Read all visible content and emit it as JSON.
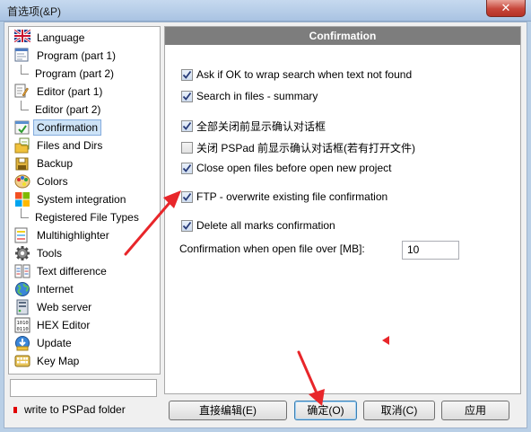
{
  "window": {
    "title": "首选项(&P)",
    "close_label": "✕"
  },
  "tree": {
    "items": [
      {
        "label": "Language",
        "icon": "uk-flag-icon",
        "level": 0
      },
      {
        "label": "Program  (part 1)",
        "icon": "program-window-icon",
        "level": 0
      },
      {
        "label": "Program  (part 2)",
        "icon": "",
        "level": 1
      },
      {
        "label": "Editor  (part 1)",
        "icon": "editor-pencil-icon",
        "level": 0
      },
      {
        "label": "Editor  (part 2)",
        "icon": "",
        "level": 1
      },
      {
        "label": "Confirmation",
        "icon": "confirmation-icon",
        "level": 0,
        "selected": true
      },
      {
        "label": "Files and Dirs",
        "icon": "files-dirs-icon",
        "level": 0
      },
      {
        "label": "Backup",
        "icon": "backup-icon",
        "level": 0
      },
      {
        "label": "Colors",
        "icon": "colors-palette-icon",
        "level": 0
      },
      {
        "label": "System integration",
        "icon": "windows-logo-icon",
        "level": 0
      },
      {
        "label": "Registered File Types",
        "icon": "",
        "level": 1
      },
      {
        "label": "Multihighlighter",
        "icon": "multihighlighter-icon",
        "level": 0
      },
      {
        "label": "Tools",
        "icon": "gear-icon",
        "level": 0
      },
      {
        "label": "Text difference",
        "icon": "text-difference-icon",
        "level": 0
      },
      {
        "label": "Internet",
        "icon": "globe-icon",
        "level": 0
      },
      {
        "label": "Web server",
        "icon": "web-server-icon",
        "level": 0
      },
      {
        "label": "HEX Editor",
        "icon": "hex-editor-icon",
        "level": 0
      },
      {
        "label": "Update",
        "icon": "update-icon",
        "level": 0
      },
      {
        "label": "Key Map",
        "icon": "keyboard-icon",
        "level": 0
      }
    ],
    "search_value": ""
  },
  "footer_note": "write to PSPad folder",
  "panel": {
    "header": "Confirmation",
    "options": [
      {
        "label": "Ask if OK to wrap search when text not found",
        "checked": true
      },
      {
        "label": "Search in files - summary",
        "checked": true
      },
      {
        "label": "全部关闭前显示确认对话框",
        "checked": true
      },
      {
        "label": "关闭 PSPad 前显示确认对话框(若有打开文件)",
        "checked": false
      },
      {
        "label": "Close open files before open new project",
        "checked": true
      },
      {
        "label": "FTP - overwrite existing file confirmation",
        "checked": true
      },
      {
        "label": "Delete all marks confirmation",
        "checked": true
      }
    ],
    "size_label": "Confirmation when open file over [MB]:",
    "size_value": "10"
  },
  "buttons": {
    "direct_edit": "直接编辑(E)",
    "ok": "确定(O)",
    "cancel": "取消(C)",
    "apply": "应用"
  },
  "colors": {
    "header_bg": "#7d7d7d",
    "annotation_red": "#e8262a"
  }
}
